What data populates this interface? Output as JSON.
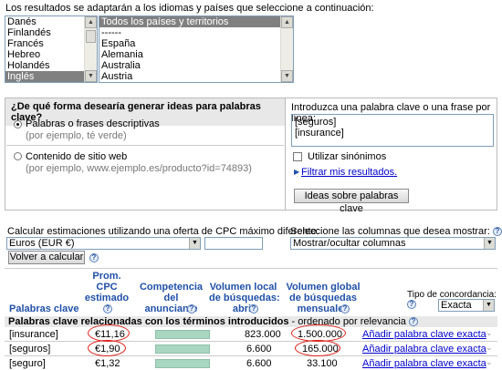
{
  "intro_text": "Los resultados se adaptarán a los idiomas y países que seleccione a continuación:",
  "languages": [
    "Danés",
    "Finlandés",
    "Francés",
    "Hebreo",
    "Holandés",
    "Inglés"
  ],
  "countries": [
    "Todos los países y territorios",
    "------",
    "España",
    "Alemania",
    "Australia",
    "Austria"
  ],
  "ideas": {
    "question": "¿De qué forma desearía generar ideas para palabras clave?",
    "opt1_title": "Palabras o frases descriptivas",
    "opt1_hint": "(por ejemplo, té verde)",
    "opt2_title": "Contenido de sitio web",
    "opt2_hint": "(por ejemplo, www.ejemplo.es/producto?id=74893)",
    "right_title": "Introduzca una palabra clave o una frase por línea:",
    "keywords_text": "[seguros]\n[insurance]",
    "synonyms_label": "Utilizar sinónimos",
    "filter_link": "Filtrar mis resultados.",
    "ideas_button": "Ideas sobre palabras clave"
  },
  "cpc": {
    "label": "Calcular estimaciones utilizando una oferta de CPC máximo diferente:",
    "currency_value": "Euros (EUR €)",
    "recalc_button": "Volver a calcular",
    "columns_label": "Seleccione las columnas que desea mostrar:",
    "columns_value": "Mostrar/ocultar columnas"
  },
  "table": {
    "col_keywords": "Palabras clave",
    "col_cpc": "Prom.\nCPC\nestimado",
    "col_competition": "Competencia\ndel\nanunciante",
    "col_local": "Volumen local\nde búsquedas:\nabril",
    "col_global": "Volumen global\nde búsquedas\nmensuales",
    "match_label": "Tipo de concordancia:",
    "match_value": "Exacta",
    "section_title": "Palabras clave relacionadas con los términos introducidos",
    "section_suffix": " - ordenado por relevancia",
    "add_link": "Añadir palabra clave exacta",
    "rows": [
      {
        "keyword": "[insurance]",
        "cpc": "€11,16",
        "competition": 1.0,
        "local": "823.000",
        "global": "1.500.000"
      },
      {
        "keyword": "[seguros]",
        "cpc": "€1,90",
        "competition": 1.0,
        "local": "6.600",
        "global": "165.000"
      },
      {
        "keyword": "[seguro]",
        "cpc": "€1,32",
        "competition": 1.0,
        "local": "6.600",
        "global": "33.100"
      }
    ]
  },
  "colors": {
    "accent": "#2050a8",
    "highlight_oval": "#e0201a",
    "competition_bar": "#a8d6c0"
  }
}
